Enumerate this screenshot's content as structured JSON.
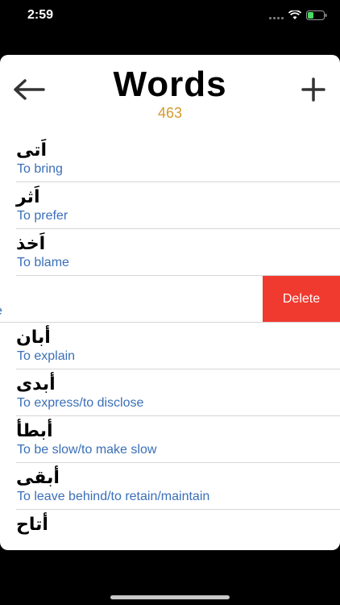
{
  "status_bar": {
    "time": "2:59"
  },
  "header": {
    "title": "Words",
    "count": "463",
    "back_icon": "arrow-left-icon",
    "add_icon": "plus-icon",
    "count_color": "#d29a2e"
  },
  "words": [
    {
      "arabic": "اَتى",
      "english": "To bring"
    },
    {
      "arabic": "اَثر",
      "english": "To prefer"
    },
    {
      "arabic": "اَخذ",
      "english": "To blame"
    },
    {
      "arabic": "",
      "english": "e",
      "swiped": true,
      "delete_label": "Delete"
    },
    {
      "arabic": "أبان",
      "english": "To explain"
    },
    {
      "arabic": "أبدى",
      "english": "To express/to disclose"
    },
    {
      "arabic": "أبطأ",
      "english": "To be slow/to make slow"
    },
    {
      "arabic": "أبقى",
      "english": "To leave behind/to retain/maintain"
    },
    {
      "arabic": "أتاح",
      "english": ""
    }
  ],
  "colors": {
    "accent_blue": "#3a6fb8",
    "delete_red": "#f03a30"
  }
}
